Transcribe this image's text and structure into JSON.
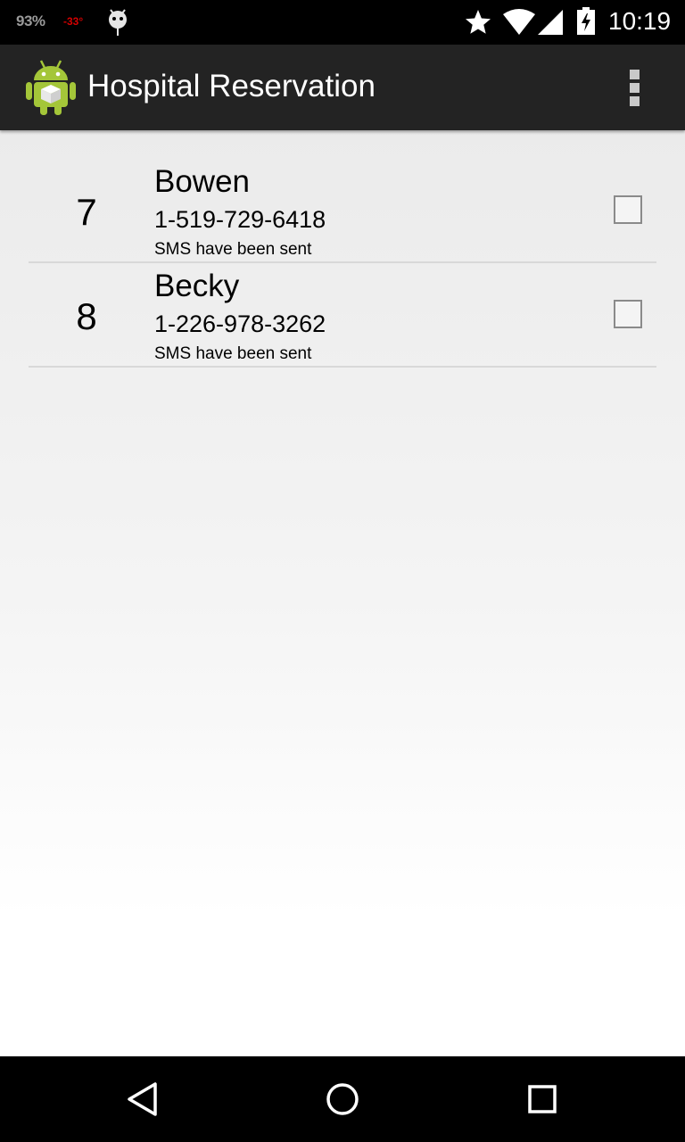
{
  "status_bar": {
    "battery_percent": "93%",
    "temperature": "-33°",
    "time": "10:19",
    "icons": [
      "debug-bug-icon",
      "star-icon",
      "wifi-icon",
      "signal-icon",
      "battery-charging-icon"
    ]
  },
  "action_bar": {
    "app_icon": "android-app-icon",
    "title": "Hospital Reservation",
    "overflow_icon": "overflow-menu-icon"
  },
  "reservations": [
    {
      "number": "7",
      "name": "Bowen",
      "phone": "1-519-729-6418",
      "status": "SMS have been sent",
      "checked": false
    },
    {
      "number": "8",
      "name": "Becky",
      "phone": "1-226-978-3262",
      "status": "SMS have been sent",
      "checked": false
    }
  ],
  "nav_bar": {
    "icons": [
      "back-icon",
      "home-icon",
      "recents-icon"
    ]
  },
  "colors": {
    "status_bar": "#000000",
    "action_bar": "#232323",
    "temperature": "#d40000",
    "android_green": "#a4c639"
  }
}
